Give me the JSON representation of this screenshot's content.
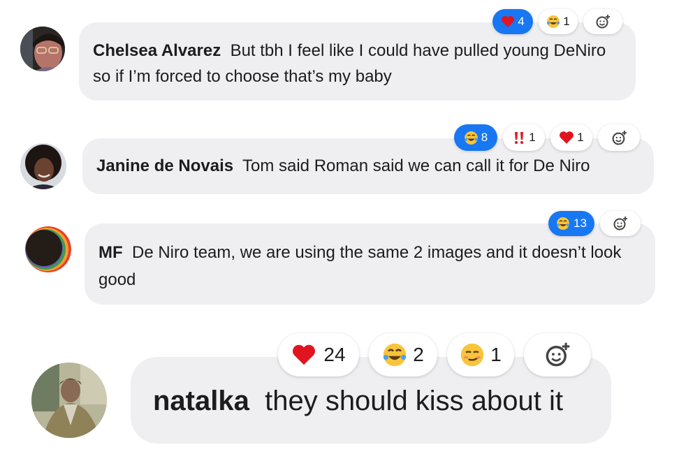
{
  "comments": [
    {
      "author": "Chelsea Alvarez",
      "text": "But tbh I feel like I could have pulled young DeNiro so if I’m forced to choose that’s my baby",
      "reactions": [
        {
          "emoji": "heart",
          "count": "4",
          "active": true
        },
        {
          "emoji": "laugh-cry",
          "count": "1",
          "active": false
        }
      ]
    },
    {
      "author": "Janine de Novais",
      "text": "Tom said Roman said we can call it for De Niro",
      "reactions": [
        {
          "emoji": "laugh-cry",
          "count": "8",
          "active": true
        },
        {
          "emoji": "double-exclamation",
          "count": "1",
          "active": false
        },
        {
          "emoji": "heart",
          "count": "1",
          "active": false
        }
      ]
    },
    {
      "author": "MF",
      "text": "De Niro team, we are using the same 2 images and it doesn’t look good",
      "reactions": [
        {
          "emoji": "laugh-cry",
          "count": "13",
          "active": true
        }
      ]
    },
    {
      "author": "natalka",
      "text": "they should kiss about it",
      "reactions": [
        {
          "emoji": "heart",
          "count": "24",
          "active": false
        },
        {
          "emoji": "laugh-cry",
          "count": "2",
          "active": false
        },
        {
          "emoji": "smirk",
          "count": "1",
          "active": false
        }
      ]
    }
  ],
  "icons": {
    "add_reaction": "add-reaction-icon",
    "heart": "heart-icon",
    "laugh_cry": "laugh-cry-icon",
    "double_exclamation": "double-exclamation-icon",
    "smirk": "smirk-icon"
  },
  "colors": {
    "active_reaction": "#1877f2",
    "bubble": "#efeff1",
    "heart": "#e0151f",
    "emoji_yellow": "#f8c43a"
  }
}
